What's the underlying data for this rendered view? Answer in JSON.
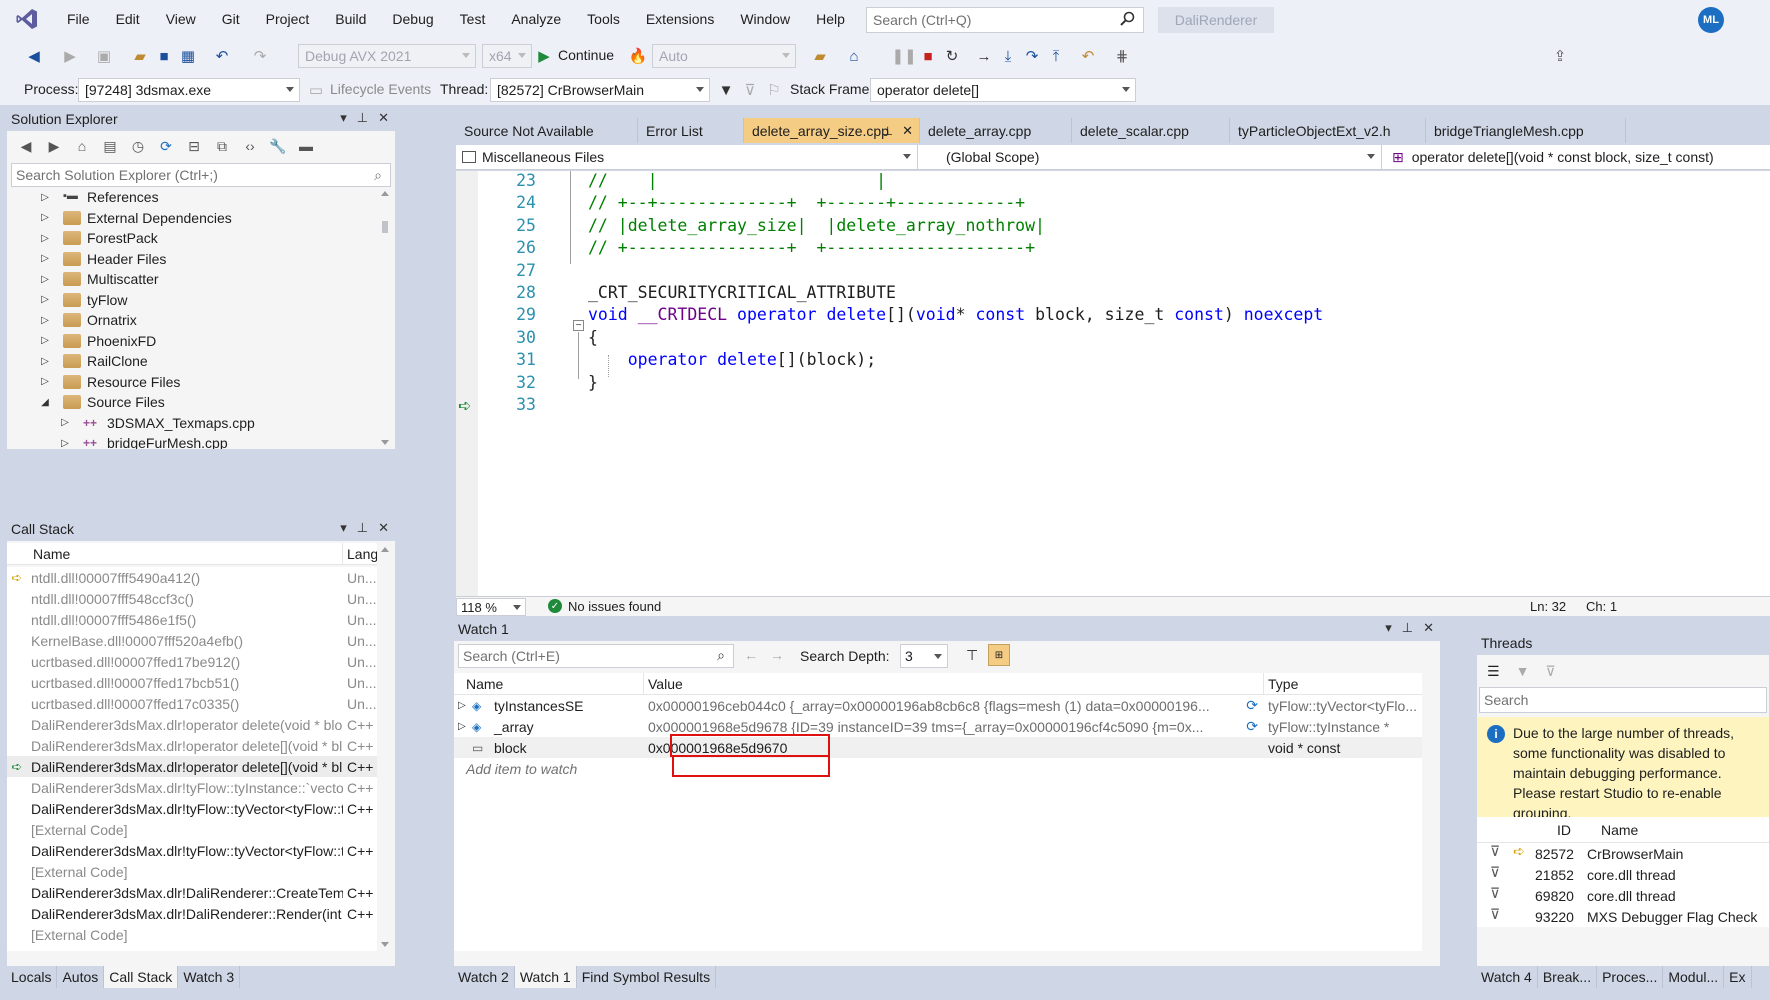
{
  "menubar": {
    "items": [
      "File",
      "Edit",
      "View",
      "Git",
      "Project",
      "Build",
      "Debug",
      "Test",
      "Analyze",
      "Tools",
      "Extensions",
      "Window",
      "Help"
    ],
    "search_placeholder": "Search (Ctrl+Q)",
    "solution_title": "DaliRenderer",
    "user_initials": "ML"
  },
  "toolbar": {
    "config": "Debug AVX 2021",
    "platform": "x64",
    "continue_label": "Continue",
    "auto_label": "Auto"
  },
  "debug_location": {
    "process_label": "Process:",
    "process_value": "[97248] 3dsmax.exe",
    "lifecycle_label": "Lifecycle Events",
    "thread_label": "Thread:",
    "thread_value": "[82572] CrBrowserMain",
    "stackframe_label": "Stack Frame:",
    "stackframe_value": "operator delete[]"
  },
  "solution_explorer": {
    "title": "Solution Explorer",
    "search_placeholder": "Search Solution Explorer (Ctrl+;)",
    "items": [
      {
        "label": "References",
        "type": "ref",
        "expanded": false,
        "indent": 0
      },
      {
        "label": "External Dependencies",
        "type": "folder",
        "expanded": false,
        "indent": 0
      },
      {
        "label": "ForestPack",
        "type": "folder",
        "expanded": false,
        "indent": 0
      },
      {
        "label": "Header Files",
        "type": "folder",
        "expanded": false,
        "indent": 0
      },
      {
        "label": "Multiscatter",
        "type": "folder",
        "expanded": false,
        "indent": 0
      },
      {
        "label": "tyFlow",
        "type": "folder",
        "expanded": false,
        "indent": 0
      },
      {
        "label": "Ornatrix",
        "type": "folder",
        "expanded": false,
        "indent": 0
      },
      {
        "label": "PhoenixFD",
        "type": "folder",
        "expanded": false,
        "indent": 0
      },
      {
        "label": "RailClone",
        "type": "folder",
        "expanded": false,
        "indent": 0
      },
      {
        "label": "Resource Files",
        "type": "folder",
        "expanded": false,
        "indent": 0
      },
      {
        "label": "Source Files",
        "type": "folder",
        "expanded": true,
        "indent": 0
      },
      {
        "label": "3DSMAX_Texmaps.cpp",
        "type": "cpp",
        "expanded": false,
        "indent": 1
      },
      {
        "label": "bridgeFurMesh.cpp",
        "type": "cpp",
        "expanded": false,
        "indent": 1
      }
    ]
  },
  "call_stack": {
    "title": "Call Stack",
    "col_name": "Name",
    "col_lang": "Lang",
    "rows": [
      {
        "name": "ntdll.dll!00007fff5490a412()",
        "lang": "Un...",
        "gray": true,
        "marker": "current"
      },
      {
        "name": "ntdll.dll!00007fff548ccf3c()",
        "lang": "Un...",
        "gray": true,
        "marker": ""
      },
      {
        "name": "ntdll.dll!00007fff5486e1f5()",
        "lang": "Un...",
        "gray": true,
        "marker": ""
      },
      {
        "name": "KernelBase.dll!00007fff520a4efb()",
        "lang": "Un...",
        "gray": true,
        "marker": ""
      },
      {
        "name": "ucrtbased.dll!00007ffed17be912()",
        "lang": "Un...",
        "gray": true,
        "marker": ""
      },
      {
        "name": "ucrtbased.dll!00007ffed17bcb51()",
        "lang": "Un...",
        "gray": true,
        "marker": ""
      },
      {
        "name": "ucrtbased.dll!00007ffed17c0335()",
        "lang": "Un...",
        "gray": true,
        "marker": ""
      },
      {
        "name": "DaliRenderer3dsMax.dlr!operator delete(void * blo...",
        "lang": "C++",
        "gray": true,
        "marker": ""
      },
      {
        "name": "DaliRenderer3dsMax.dlr!operator delete[](void * bl...",
        "lang": "C++",
        "gray": true,
        "marker": ""
      },
      {
        "name": "DaliRenderer3dsMax.dlr!operator delete[](void * bl...",
        "lang": "C++",
        "gray": false,
        "marker": "selected"
      },
      {
        "name": "DaliRenderer3dsMax.dlr!tyFlow::tyInstance::`vector d...",
        "lang": "C++",
        "gray": true,
        "marker": ""
      },
      {
        "name": "DaliRenderer3dsMax.dlr!tyFlow::tyVector<tyFlow::tyl...",
        "lang": "C++",
        "gray": false,
        "marker": ""
      },
      {
        "name": "[External Code]",
        "lang": "",
        "gray": true,
        "marker": ""
      },
      {
        "name": "DaliRenderer3dsMax.dlr!tyFlow::tyVector<tyFlow::tyl...",
        "lang": "C++",
        "gray": false,
        "marker": ""
      },
      {
        "name": "[External Code]",
        "lang": "",
        "gray": true,
        "marker": ""
      },
      {
        "name": "DaliRenderer3dsMax.dlr!DaliRenderer::CreateTemp...",
        "lang": "C++",
        "gray": false,
        "marker": ""
      },
      {
        "name": "DaliRenderer3dsMax.dlr!DaliRenderer::Render(int _t...",
        "lang": "C++",
        "gray": false,
        "marker": ""
      },
      {
        "name": "[External Code]",
        "lang": "",
        "gray": true,
        "marker": ""
      }
    ]
  },
  "left_bottom_tabs": [
    "Locals",
    "Autos",
    "Call Stack",
    "Watch 3"
  ],
  "left_bottom_active": "Call Stack",
  "doc_tabs": [
    {
      "label": "Source Not Available",
      "active": false
    },
    {
      "label": "Error List",
      "active": false
    },
    {
      "label": "delete_array_size.cpp",
      "active": true
    },
    {
      "label": "delete_array.cpp",
      "active": false
    },
    {
      "label": "delete_scalar.cpp",
      "active": false
    },
    {
      "label": "tyParticleObjectExt_v2.h",
      "active": false
    },
    {
      "label": "bridgeTriangleMesh.cpp",
      "active": false
    }
  ],
  "navbar": {
    "project": "Miscellaneous Files",
    "scope": "(Global Scope)",
    "member": "operator delete[](void * const block, size_t const)"
  },
  "editor": {
    "lines": [
      {
        "num": "23",
        "text": "//    |                      |"
      },
      {
        "num": "24",
        "text": "// +--+-------------+  +------+------------+"
      },
      {
        "num": "25",
        "text": "// |delete_array_size|  |delete_array_nothrow|"
      },
      {
        "num": "26",
        "text": "// +----------------+  +--------------------+"
      },
      {
        "num": "27",
        "text": ""
      },
      {
        "num": "28",
        "text": "_CRT_SECURITYCRITICAL_ATTRIBUTE"
      },
      {
        "num": "29",
        "text": "void __CRTDECL operator delete[](void* const block, size_t const) noexcept"
      },
      {
        "num": "30",
        "text": "{"
      },
      {
        "num": "31",
        "text": "    operator delete[](block);"
      },
      {
        "num": "32",
        "text": "}"
      },
      {
        "num": "33",
        "text": ""
      }
    ],
    "zoom": "118 %",
    "issues": "No issues found",
    "ln": "Ln: 32",
    "ch": "Ch: 1"
  },
  "watch": {
    "title": "Watch 1",
    "search_placeholder": "Search (Ctrl+E)",
    "search_depth_label": "Search Depth:",
    "search_depth_value": "3",
    "col_name": "Name",
    "col_value": "Value",
    "col_type": "Type",
    "rows": [
      {
        "name": "tyInstancesSE",
        "value": "0x00000196ceb044c0 {_array=0x00000196ab8cb6c8 {flags=mesh (1) data=0x00000196...",
        "type": "tyFlow::tyVector<tyFlo..."
      },
      {
        "name": "_array",
        "value": "0x000001968e5d9678 {ID=39 instanceID=39 tms={_array=0x00000196cf4c5090 {m=0x...",
        "type": "tyFlow::tyInstance *"
      },
      {
        "name": "block",
        "value": "0x000001968e5d9670",
        "type": "void * const"
      }
    ],
    "add_item": "Add item to watch"
  },
  "middle_bottom_tabs": [
    "Watch 2",
    "Watch 1",
    "Find Symbol Results"
  ],
  "middle_bottom_active": "Watch 1",
  "threads": {
    "title": "Threads",
    "search_placeholder": "Search",
    "info": "Due to the large number of threads, some functionality was disabled to maintain debugging performance. Please restart Studio to re-enable grouping.",
    "col_id": "ID",
    "col_name": "Name",
    "rows": [
      {
        "id": "82572",
        "name": "CrBrowserMain",
        "current": true
      },
      {
        "id": "21852",
        "name": "core.dll thread",
        "current": false
      },
      {
        "id": "69820",
        "name": "core.dll thread",
        "current": false
      },
      {
        "id": "93220",
        "name": "MXS Debugger Flag Check",
        "current": false
      }
    ]
  },
  "right_bottom_tabs": [
    "Watch 4",
    "Break...",
    "Proces...",
    "Modul...",
    "Ex"
  ],
  "colors": {
    "frame": "#cfd6e5",
    "active_tab": "#f5cc84",
    "highlight_box": "#e01010",
    "accent": "#1b6ec2"
  }
}
